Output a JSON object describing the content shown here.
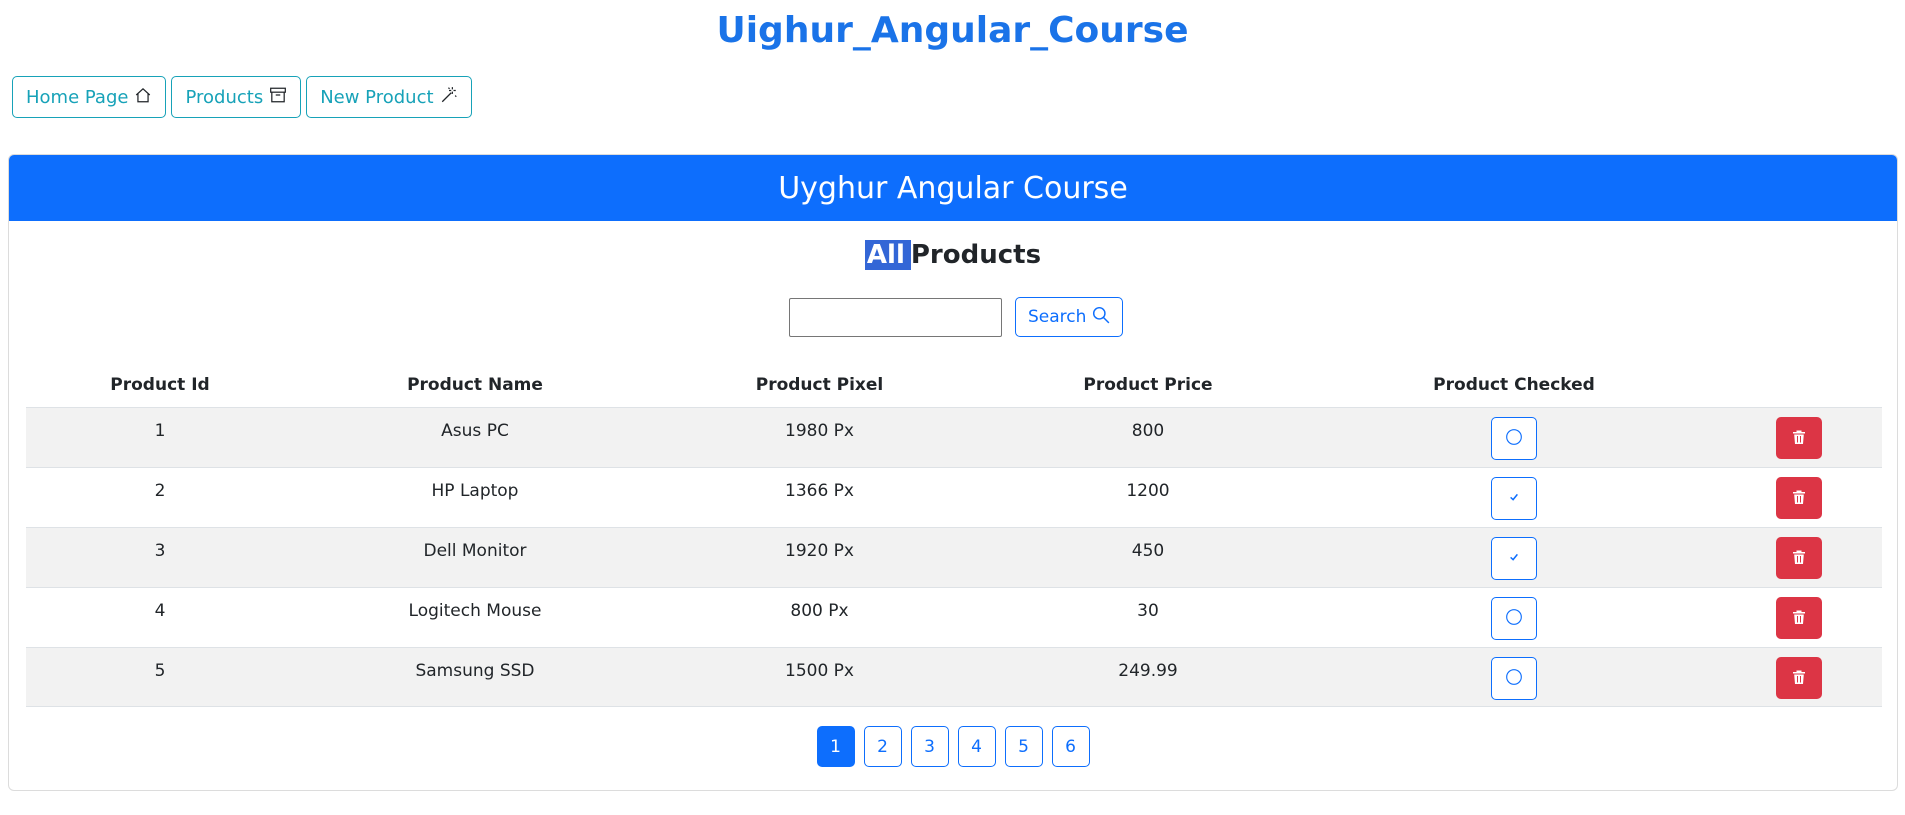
{
  "app": {
    "title": "Uighur_Angular_Course"
  },
  "nav": [
    {
      "label": "Home Page",
      "icon": "house-icon"
    },
    {
      "label": "Products",
      "icon": "archive-icon"
    },
    {
      "label": "New Product",
      "icon": "magic-wand-icon"
    }
  ],
  "card": {
    "header": "Uyghur Angular Course"
  },
  "section": {
    "title_highlight": "All",
    "title_rest": "Products"
  },
  "search": {
    "value": "",
    "button_label": "Search",
    "icon": "search-icon"
  },
  "table": {
    "headers": [
      "Product Id",
      "Product Name",
      "Product Pixel",
      "Product Price",
      "Product Checked"
    ],
    "rows": [
      {
        "id": "1",
        "name": "Asus PC",
        "pixel": "1980 Px",
        "price": "800",
        "checked": false
      },
      {
        "id": "2",
        "name": "HP Laptop",
        "pixel": "1366 Px",
        "price": "1200",
        "checked": true
      },
      {
        "id": "3",
        "name": "Dell Monitor",
        "pixel": "1920 Px",
        "price": "450",
        "checked": true
      },
      {
        "id": "4",
        "name": "Logitech Mouse",
        "pixel": "800 Px",
        "price": "30",
        "checked": false
      },
      {
        "id": "5",
        "name": "Samsung SSD",
        "pixel": "1500 Px",
        "price": "249.99",
        "checked": false
      }
    ]
  },
  "pagination": {
    "pages": [
      "1",
      "2",
      "3",
      "4",
      "5",
      "6"
    ],
    "current": "1"
  },
  "colors": {
    "primary": "#0d6efd",
    "info": "#17a2b8",
    "danger": "#dc3545",
    "title": "#1a73e8"
  }
}
